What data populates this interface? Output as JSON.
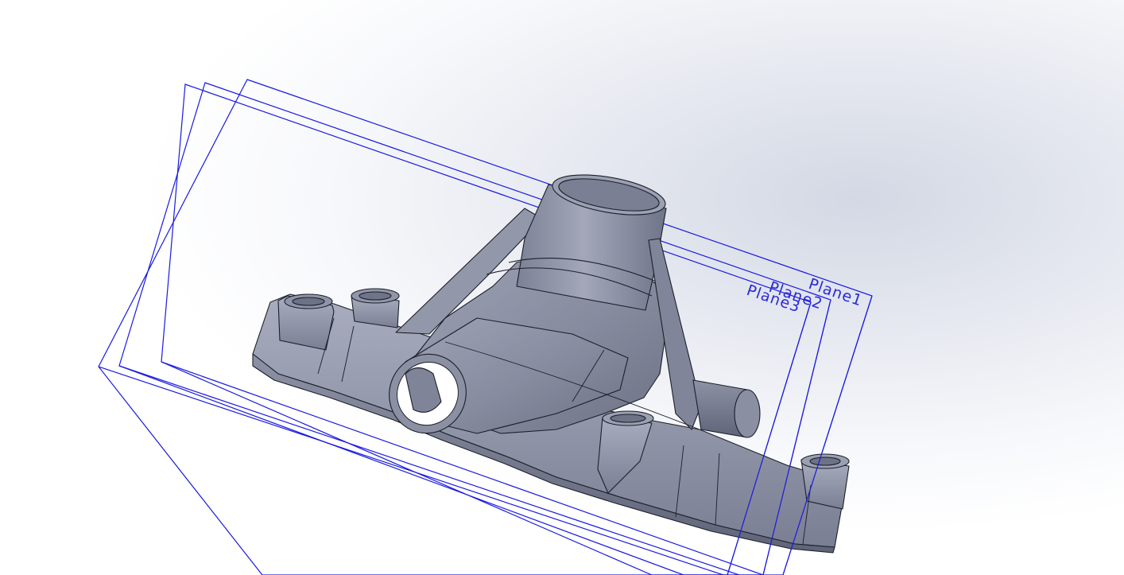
{
  "planes": [
    {
      "label": "Plane1"
    },
    {
      "label": "Plane2"
    },
    {
      "label": "Plane3"
    }
  ],
  "colors": {
    "plane_outline": "#1a1ae0",
    "plane_label": "#2b2bd6",
    "part_fill": "#8a8fa3",
    "part_edge": "#1c1f2a"
  }
}
